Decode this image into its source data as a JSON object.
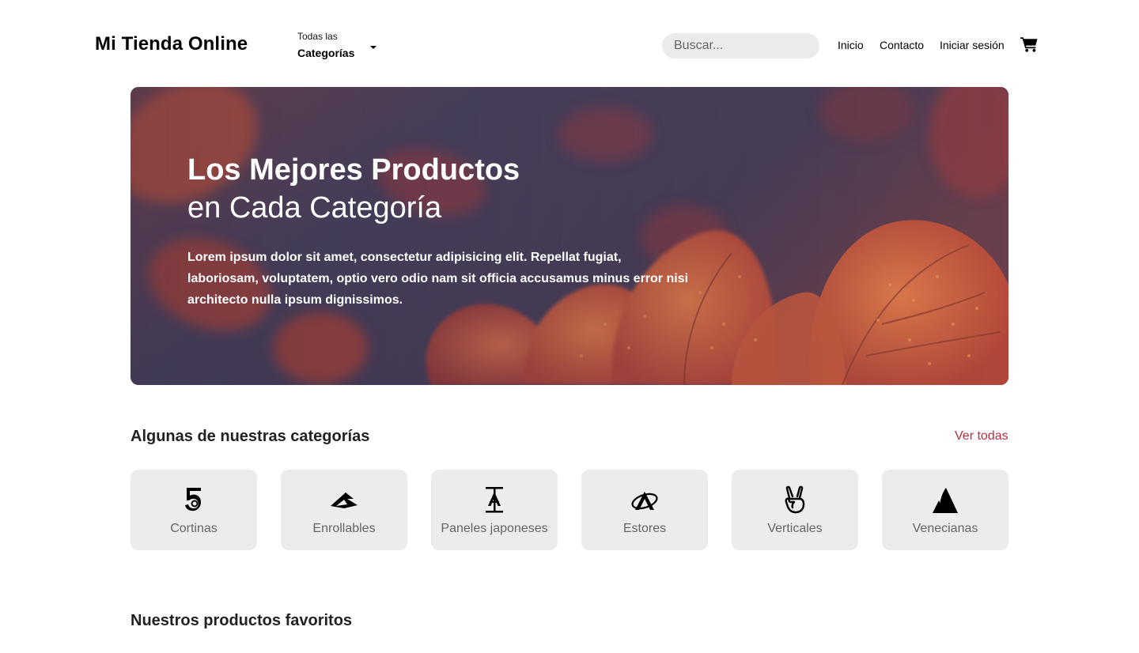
{
  "header": {
    "logo": "Mi Tienda Online",
    "categories_dropdown": {
      "small_label": "Todas las",
      "label": "Categorías"
    },
    "search": {
      "placeholder": "Buscar...",
      "value": ""
    },
    "nav": {
      "home": "Inicio",
      "contact": "Contacto",
      "login": "Iniciar sesión"
    },
    "cart_icon": "shopping-cart-icon"
  },
  "hero": {
    "title_line1": "Los Mejores Productos",
    "title_line2": "en Cada Categoría",
    "text": "Lorem ipsum dolor sit amet, consectetur adipisicing elit. Repellat fugiat, laboriosam, voluptatem, optio vero odio nam sit officia accusamus minus error nisi architecto nulla ipsum dignissimos."
  },
  "categories_section": {
    "title": "Algunas de nuestras categorías",
    "see_all": "Ver todas",
    "items": [
      {
        "label": "Cortinas",
        "icon": "500px-icon"
      },
      {
        "label": "Enrollables",
        "icon": "accusoft-icon"
      },
      {
        "label": "Paneles japoneses",
        "icon": "adversal-icon"
      },
      {
        "label": "Estores",
        "icon": "affiliatetheme-icon"
      },
      {
        "label": "Verticales",
        "icon": "angellist-icon"
      },
      {
        "label": "Venecianas",
        "icon": "atlassian-icon"
      }
    ]
  },
  "favorites_section": {
    "title": "Nuestros productos favoritos"
  },
  "colors": {
    "accent": "#b5303f",
    "card_bg": "#ececec",
    "search_bg": "#ebebeb"
  }
}
